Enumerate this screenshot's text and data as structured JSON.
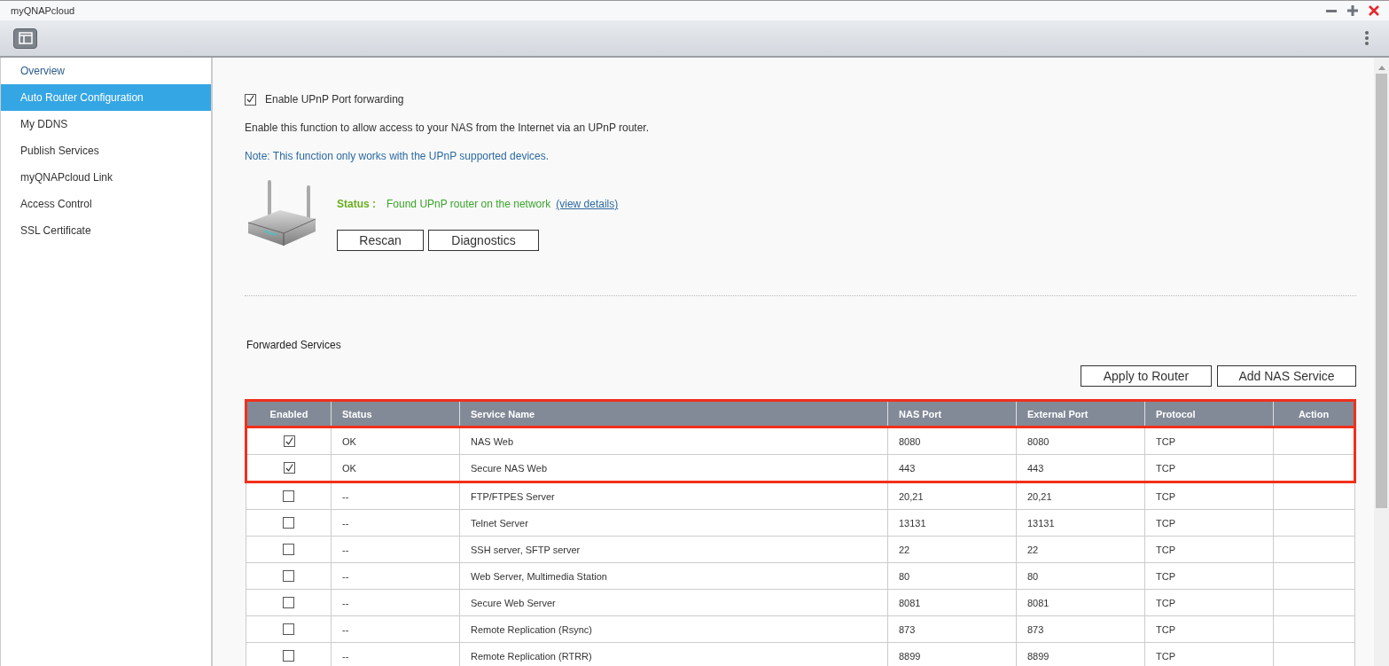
{
  "window": {
    "title": "myQNAPcloud"
  },
  "sidebar": {
    "items": [
      {
        "label": "Overview",
        "selected": false
      },
      {
        "label": "Auto Router Configuration",
        "selected": true
      },
      {
        "label": "My DDNS",
        "selected": false
      },
      {
        "label": "Publish Services",
        "selected": false
      },
      {
        "label": "myQNAPcloud Link",
        "selected": false
      },
      {
        "label": "Access Control",
        "selected": false
      },
      {
        "label": "SSL Certificate",
        "selected": false
      }
    ]
  },
  "upnp": {
    "label": "Enable UPnP Port forwarding",
    "checked": true,
    "description": "Enable this function to allow access to your NAS from the Internet via an UPnP router.",
    "note": "Note: This function only works with the UPnP supported devices.",
    "status_label": "Status :",
    "status_text": "Found UPnP router on the network",
    "details_link": "(view details)",
    "buttons": [
      "Rescan",
      "Diagnostics"
    ]
  },
  "forwarded": {
    "title": "Forwarded Services",
    "buttons": [
      "Apply to Router",
      "Add NAS Service"
    ],
    "table": {
      "columns": [
        "Enabled",
        "Status",
        "Service Name",
        "NAS Port",
        "External Port",
        "Protocol",
        "Action"
      ],
      "rows": [
        {
          "enabled": true,
          "highlighted": true,
          "status": "OK",
          "service": "NAS Web",
          "nas_port": "8080",
          "external_port": "8080",
          "protocol": "TCP"
        },
        {
          "enabled": true,
          "highlighted": true,
          "status": "OK",
          "service": "Secure NAS Web",
          "nas_port": "443",
          "external_port": "443",
          "protocol": "TCP"
        },
        {
          "enabled": false,
          "highlighted": false,
          "status": "--",
          "service": "FTP/FTPES Server",
          "nas_port": "20,21",
          "external_port": "20,21",
          "protocol": "TCP"
        },
        {
          "enabled": false,
          "highlighted": false,
          "status": "--",
          "service": "Telnet Server",
          "nas_port": "13131",
          "external_port": "13131",
          "protocol": "TCP"
        },
        {
          "enabled": false,
          "highlighted": false,
          "status": "--",
          "service": "SSH server, SFTP server",
          "nas_port": "22",
          "external_port": "22",
          "protocol": "TCP"
        },
        {
          "enabled": false,
          "highlighted": false,
          "status": "--",
          "service": "Web Server, Multimedia Station",
          "nas_port": "80",
          "external_port": "80",
          "protocol": "TCP"
        },
        {
          "enabled": false,
          "highlighted": false,
          "status": "--",
          "service": "Secure Web Server",
          "nas_port": "8081",
          "external_port": "8081",
          "protocol": "TCP"
        },
        {
          "enabled": false,
          "highlighted": false,
          "status": "--",
          "service": "Remote Replication (Rsync)",
          "nas_port": "873",
          "external_port": "873",
          "protocol": "TCP"
        },
        {
          "enabled": false,
          "highlighted": false,
          "status": "--",
          "service": "Remote Replication (RTRR)",
          "nas_port": "8899",
          "external_port": "8899",
          "protocol": "TCP"
        }
      ]
    }
  }
}
